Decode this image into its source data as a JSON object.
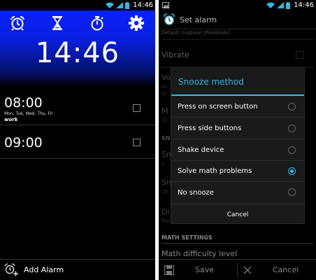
{
  "status": {
    "time": "14:46"
  },
  "left": {
    "toolbar_icons": [
      "alarm-clock-icon",
      "hourglass-icon",
      "stopwatch-icon",
      "gear-icon"
    ],
    "clock": "14:46",
    "alarms": [
      {
        "time": "08:00",
        "days": "Mon, Tue, Wed, Thu, Fri",
        "label": "work"
      },
      {
        "time": "09:00",
        "days": "",
        "label": ""
      }
    ],
    "add_alarm": "Add Alarm"
  },
  "right": {
    "title": "Set alarm",
    "bg": {
      "ringtone": "Default ringtone (Pinokkale)",
      "vibrate": "Vibrate",
      "frag_vo": "Vo",
      "frag_vo_sub": "Vo",
      "frag_in": "In",
      "frag_m": "M",
      "frag_m_sub": "10",
      "frag_sn": "SN",
      "frag_sn1": "Sn",
      "frag_s1": "S",
      "frag_sn2": "Sn",
      "frag_sn2_sub": "10",
      "frag_di": "Di",
      "frag_di_sub": "Pre",
      "math_header": "MATH SETTINGS",
      "math_level": "Math difficulty level"
    },
    "dialog": {
      "title": "Snooze method",
      "options": [
        {
          "label": "Press on screen button",
          "selected": false
        },
        {
          "label": "Press side buttons",
          "selected": false
        },
        {
          "label": "Shake device",
          "selected": false
        },
        {
          "label": "Solve math problems",
          "selected": true
        },
        {
          "label": "No snooze",
          "selected": false
        }
      ],
      "cancel": "Cancel"
    },
    "actions": {
      "save": "Save",
      "cancel": "Cancel"
    }
  },
  "colors": {
    "accent": "#35b6e5",
    "clock_bg": "#0a20ff"
  }
}
